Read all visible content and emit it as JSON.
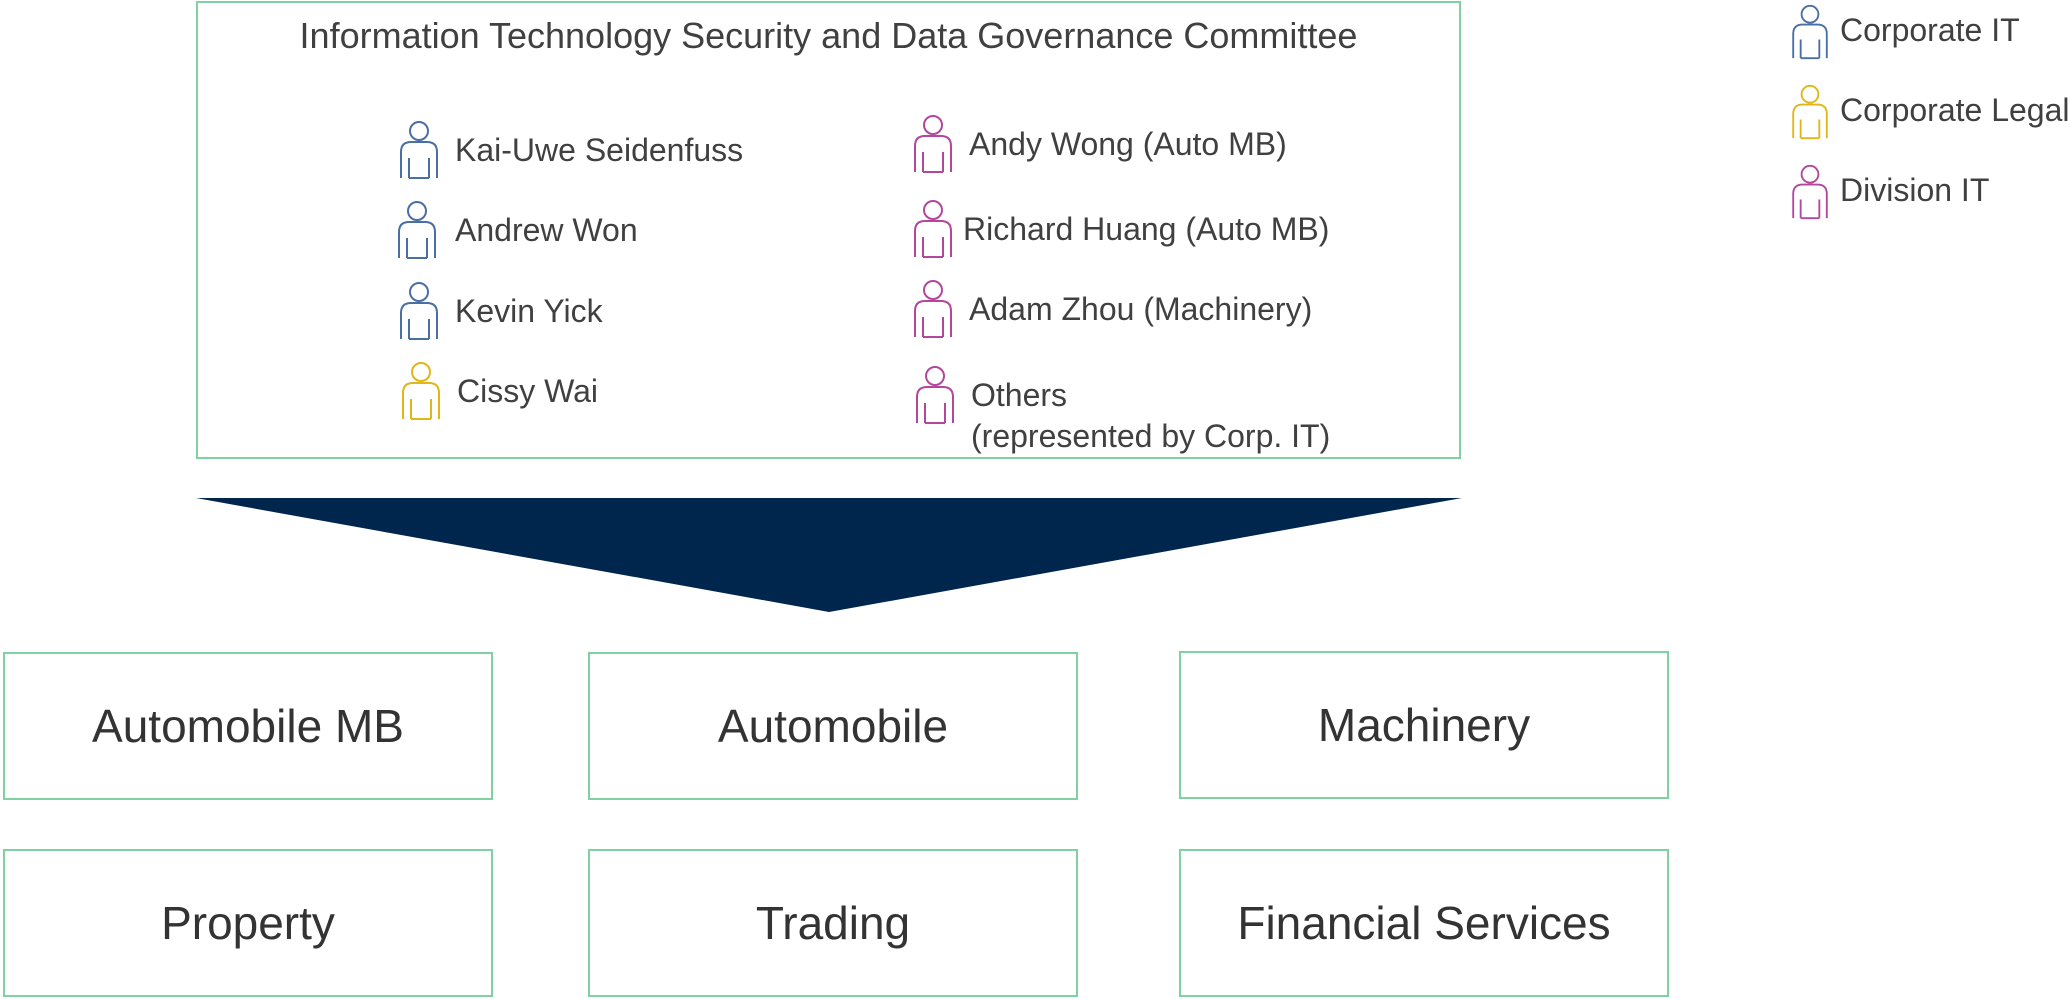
{
  "committee": {
    "title": "Information Technology Security and Data Governance Committee",
    "members_left": [
      {
        "name": "Kai-Uwe Seidenfuss",
        "group": "corporate-it"
      },
      {
        "name": "Andrew Won",
        "group": "corporate-it"
      },
      {
        "name": "Kevin Yick",
        "group": "corporate-it"
      },
      {
        "name": "Cissy Wai",
        "group": "corporate-legal"
      }
    ],
    "members_right": [
      {
        "name": "Andy Wong (Auto MB)",
        "group": "division-it"
      },
      {
        "name": "Richard Huang (Auto MB)",
        "group": "division-it"
      },
      {
        "name": "Adam Zhou (Machinery)",
        "group": "division-it"
      },
      {
        "name": "Others",
        "name_line2": "(represented by Corp. IT)",
        "group": "division-it"
      }
    ]
  },
  "legend": [
    {
      "label": "Corporate IT",
      "color": "#4a6fa5"
    },
    {
      "label": "Corporate Legal",
      "color": "#e0b619"
    },
    {
      "label": "Division IT",
      "color": "#b3479c"
    }
  ],
  "arrow": {
    "color": "#00264d",
    "icon": "down-arrow-icon"
  },
  "divisions": {
    "row1": [
      "Automobile MB",
      "Automobile",
      "Machinery"
    ],
    "row2": [
      "Property",
      "Trading",
      "Financial Services"
    ]
  },
  "colors": {
    "border": "#7fd1a1",
    "corporate_it": "#4a6fa5",
    "corporate_legal": "#e0b619",
    "division_it": "#b3479c"
  }
}
